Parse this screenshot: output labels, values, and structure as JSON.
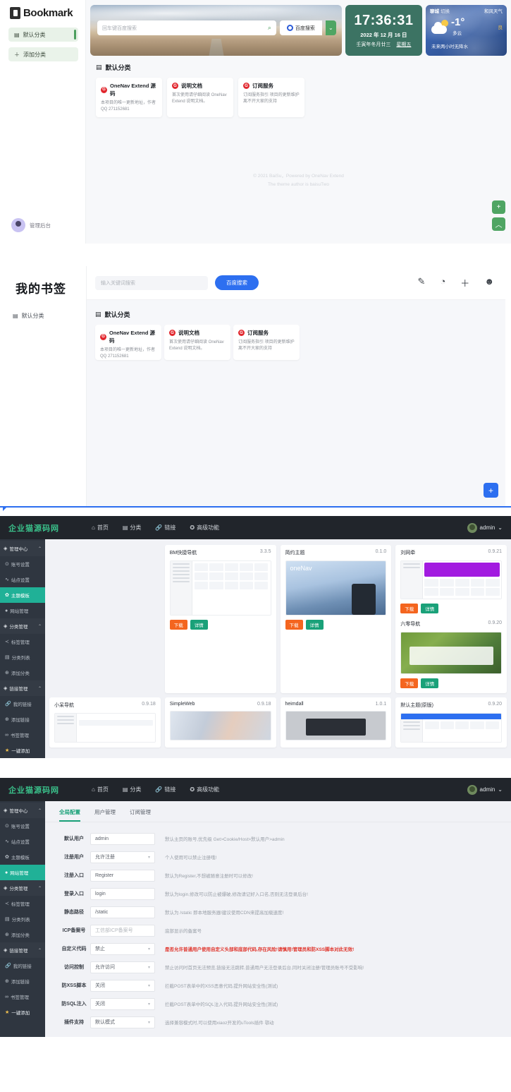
{
  "panel1": {
    "brand": "Bookmark",
    "sidebar": {
      "category": "默认分类",
      "add_category": "添加分类",
      "user": "管理后台"
    },
    "search": {
      "placeholder": "回车键百度搜索",
      "engine_label": "百度搜索"
    },
    "clock": {
      "time": "17:36:31",
      "date": "2022 年 12 月 16 日",
      "lunar": "壬寅年冬月廿三",
      "weekday": "星期五"
    },
    "weather": {
      "city": "聊城",
      "switch": "切换",
      "provider": "和风天气",
      "temp": "-1°",
      "desc": "多云",
      "aqi": "良",
      "forecast": "未来两小时无降水"
    },
    "section_title": "默认分类",
    "cards": [
      {
        "badge": "G",
        "title": "OneNav Extend 源码",
        "desc": "本项目的唯一更新地址，作者QQ 271152681"
      },
      {
        "badge": "G",
        "title": "说明文档",
        "desc": "首次使用请仔细阅读 OneNav Extend 说明文档。"
      },
      {
        "badge": "G",
        "title": "订阅服务",
        "desc": "订阅服务指引 项目的更新维护离不开大家的支持"
      }
    ],
    "footer": {
      "line1": "© 2021 BaiSu，Powered by OneNav Extend",
      "line2": "The theme author is baisuTwo"
    },
    "fab_add": "+",
    "fab_top": "︿"
  },
  "panel2": {
    "title": "我的书签",
    "sidebar_category": "默认分类",
    "search": {
      "placeholder": "输入关键词搜索",
      "button": "百度搜索"
    },
    "icons": [
      "pen-icon",
      "palette-icon",
      "plus-icon",
      "user-icon"
    ],
    "section_title": "默认分类",
    "cards": [
      {
        "badge": "G",
        "title": "OneNav Extend 源码",
        "desc": "本项目的唯一更新地址，作者QQ 271152681"
      },
      {
        "badge": "G",
        "title": "说明文档",
        "desc": "首次使用请仔细阅读 OneNav Extend 说明文档。"
      },
      {
        "badge": "G",
        "title": "订阅服务",
        "desc": "订阅服务指引 项目的更新维护离不开大家的支持"
      }
    ],
    "fab_add": "+"
  },
  "admin": {
    "brand": "企业猫源码网",
    "nav": [
      {
        "icon": "home-icon",
        "glyph": "⌂",
        "label": "首页"
      },
      {
        "icon": "grid-icon",
        "glyph": "▤",
        "label": "分类"
      },
      {
        "icon": "link-icon",
        "glyph": "🔗",
        "label": "链接"
      },
      {
        "icon": "star-icon",
        "glyph": "✪",
        "label": "高级功能"
      }
    ],
    "user": "admin",
    "user_caret": "⌄",
    "sidebar": [
      {
        "type": "group",
        "icon": "tag-icon",
        "glyph": "◈",
        "label": "管理中心",
        "chev": "⌃"
      },
      {
        "type": "item",
        "icon": "account-icon",
        "glyph": "⊙",
        "label": "账号设置"
      },
      {
        "type": "item",
        "icon": "site-icon",
        "glyph": "∿",
        "label": "站点设置"
      },
      {
        "type": "item",
        "icon": "theme-icon",
        "glyph": "✿",
        "label": "主题模板",
        "active": true
      },
      {
        "type": "item",
        "icon": "web-icon",
        "glyph": "●",
        "label": "网站管理"
      },
      {
        "type": "group",
        "icon": "tag-icon",
        "glyph": "◈",
        "label": "分类管理",
        "chev": "⌃"
      },
      {
        "type": "item",
        "icon": "share-icon",
        "glyph": "≺",
        "label": "标签管理"
      },
      {
        "type": "item",
        "icon": "list-icon",
        "glyph": "▤",
        "label": "分类列表"
      },
      {
        "type": "item",
        "icon": "plus-circle-icon",
        "glyph": "⊕",
        "label": "添加分类"
      },
      {
        "type": "group",
        "icon": "tag-icon",
        "glyph": "◈",
        "label": "链接管理",
        "chev": "⌃"
      },
      {
        "type": "item",
        "icon": "link-icon",
        "glyph": "🔗",
        "label": "我的链接"
      },
      {
        "type": "item",
        "icon": "plus-circle-icon",
        "glyph": "⊕",
        "label": "添加链接"
      },
      {
        "type": "item",
        "icon": "bookmark-icon",
        "glyph": "∞",
        "label": "书签管理"
      },
      {
        "type": "item",
        "icon": "star-icon",
        "glyph": "★",
        "label": "一键添加",
        "star": true
      }
    ],
    "themes_buttons": {
      "download": "下载",
      "detail": "详情"
    },
    "themes": [
      {
        "name": "BM快捷导航",
        "version": "3.3.5",
        "shot": "dashboard"
      },
      {
        "name": "简约主题",
        "version": "0.1.0",
        "shot": "onenav"
      },
      {
        "name": "刘网牵",
        "version": "0.9.21",
        "shot": "purple"
      },
      {
        "name": "六零导航",
        "version": "0.9.20",
        "shot": "green"
      },
      {
        "name": "小呆导航",
        "version": "0.9.18",
        "shot": "dashboard"
      },
      {
        "name": "SimpleWeb",
        "version": "0.9.18",
        "shot": "photo"
      },
      {
        "name": "heimdall",
        "version": "1.0.1",
        "shot": "gray"
      },
      {
        "name": "默认主题(原版)",
        "version": "0.9.20",
        "shot": "blue"
      }
    ]
  },
  "settings": {
    "tabs": [
      {
        "label": "全局配置",
        "active": true
      },
      {
        "label": "用户管理",
        "active": false
      },
      {
        "label": "订阅管理",
        "active": false
      }
    ],
    "rows": [
      {
        "label": "默认用户",
        "type": "text",
        "value": "admin",
        "hint": "默认主页的账号,优先级 Get>Cookie/Host>默认用户>admin",
        "warn": false
      },
      {
        "label": "注册用户",
        "type": "select",
        "value": "允许注册",
        "hint": "个人使用可以禁止注册哦!",
        "warn": false
      },
      {
        "label": "注册入口",
        "type": "text",
        "value": "Register",
        "hint": "默认为Register,不想被随意注册时可以修改!",
        "warn": false
      },
      {
        "label": "登录入口",
        "type": "text",
        "value": "login",
        "hint": "默认为login,修改可以防止被爆破,修改请记好入口名,否则无法登录后台!",
        "warn": false
      },
      {
        "label": "静态路径",
        "type": "text",
        "value": "/static",
        "hint": "默认为 /static 即本地服务器!建议使用CDN来提高加载速度!",
        "warn": false
      },
      {
        "label": "ICP备案号",
        "type": "placeholder",
        "value": "工信部ICP备案号",
        "hint": "底部显示的备案号",
        "warn": false
      },
      {
        "label": "自定义代码",
        "type": "select",
        "value": "禁止",
        "hint": "是否允许普通用户使用自定义头部和底部代码,存在风险!请慎用!管理员和防XSS脚本对此无效!",
        "warn": true
      },
      {
        "label": "访问控制",
        "type": "select",
        "value": "允许访问",
        "hint": "禁止访问时首页无法预览,链接无法跳转,普通用户无法登录后台,同时关闭注册!管理员账号不受影响!",
        "warn": false
      },
      {
        "label": "防XSS脚本",
        "type": "select",
        "value": "关闭",
        "hint": "拦截POST表单中的XSS恶意代码,提升网站安全性(测试)",
        "warn": false
      },
      {
        "label": "防SQL注入",
        "type": "select",
        "value": "关闭",
        "hint": "拦截POST表单中的SQL注入代码,提升网站安全性(测试)",
        "warn": false
      },
      {
        "label": "插件支持",
        "type": "select",
        "value": "默认模式",
        "hint": "选择兼容模式时,可以使用xiaoz开发的uTools插件 鄂动",
        "warn": false
      }
    ]
  }
}
